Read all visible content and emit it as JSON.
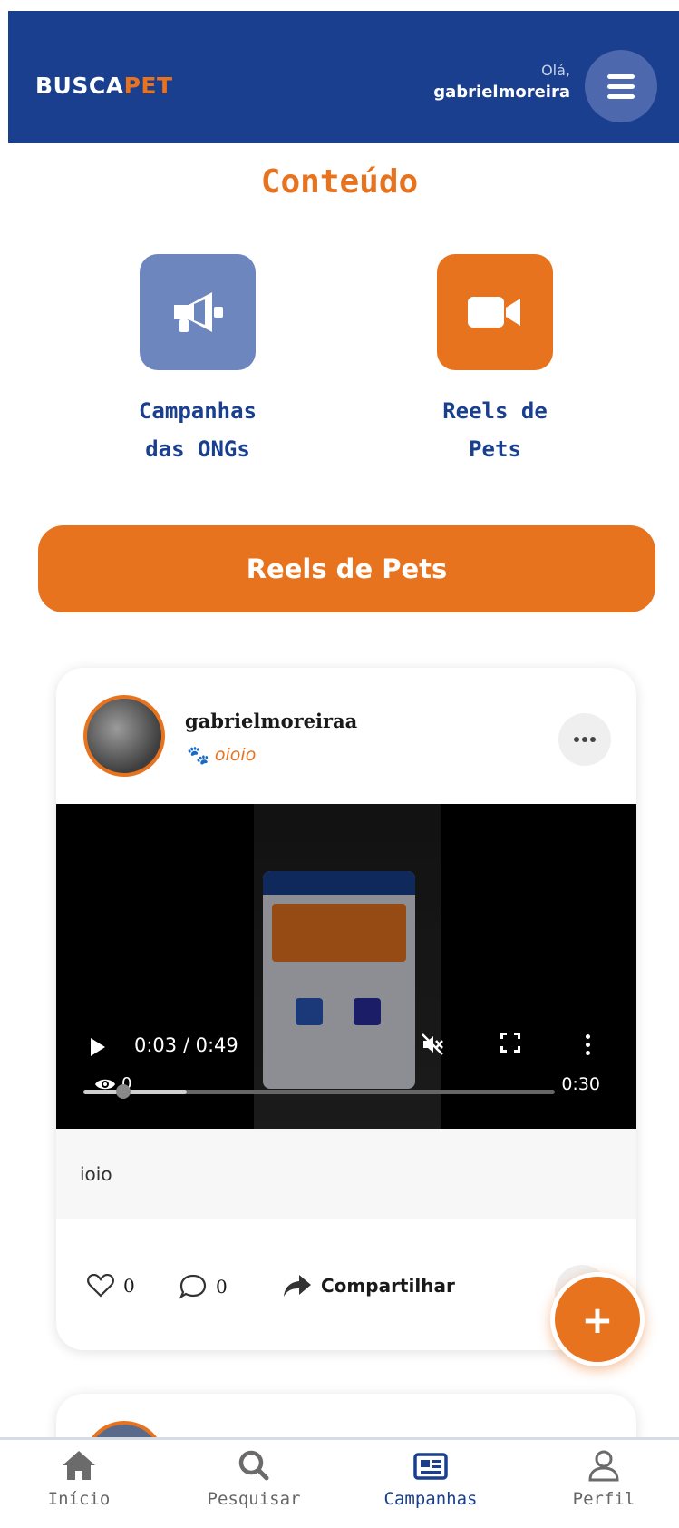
{
  "header": {
    "logo_part1": "BUSCA",
    "logo_part2": "PET",
    "greeting": "Olá,",
    "username": "gabrielmoreira",
    "menu_icon": "hamburger-icon"
  },
  "content": {
    "title": "Conteúdo",
    "categories": [
      {
        "label_line1": "Campanhas",
        "label_line2": "das ONGs",
        "icon": "megaphone-icon",
        "color": "#6d86bd"
      },
      {
        "label_line1": "Reels de",
        "label_line2": "Pets",
        "icon": "video-camera-icon",
        "color": "#e8731f"
      }
    ],
    "banner": "Reels de Pets"
  },
  "post": {
    "author": "gabrielmoreiraa",
    "pet_name": "oioio",
    "caption": "ioio",
    "video": {
      "current_time": "0:03 / 0:49",
      "views": "0",
      "duration": "0:30",
      "progress_fraction": 0.22
    },
    "likes": "0",
    "comments": "0",
    "share_label": "Compartilhar"
  },
  "fab_label": "+",
  "nav": {
    "items": [
      {
        "label": "Início",
        "icon": "home-icon"
      },
      {
        "label": "Pesquisar",
        "icon": "search-icon"
      },
      {
        "label": "Campanhas",
        "icon": "newspaper-icon"
      },
      {
        "label": "Perfil",
        "icon": "user-icon"
      }
    ],
    "active": "Campanhas"
  },
  "colors": {
    "primary": "#1a3f8f",
    "accent": "#e8731f"
  }
}
